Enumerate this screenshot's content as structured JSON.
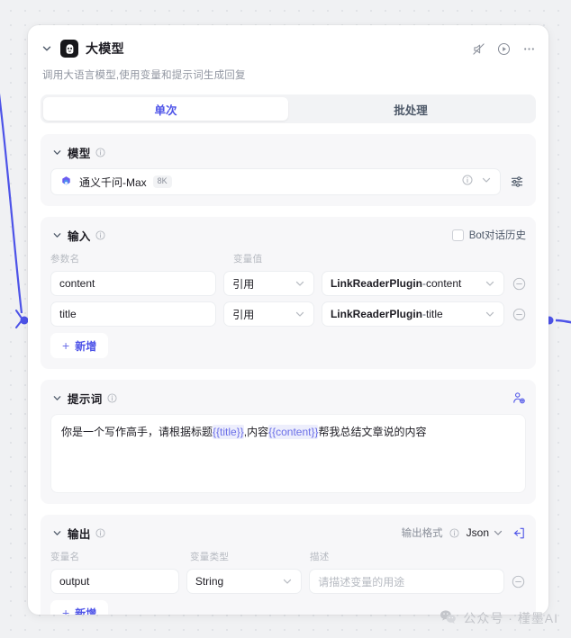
{
  "node": {
    "title": "大模型",
    "description": "调用大语言模型,使用变量和提示词生成回复",
    "avatar_icon": "bot-face-icon",
    "header_actions": [
      {
        "icon": "mute-disabled-icon",
        "name": "toggle-mute-button"
      },
      {
        "icon": "play-circle-icon",
        "name": "run-node-button"
      },
      {
        "icon": "ellipsis-icon",
        "name": "more-options-button"
      }
    ]
  },
  "tabs": [
    {
      "label": "单次",
      "active": true
    },
    {
      "label": "批处理",
      "active": false
    }
  ],
  "model_section": {
    "title": "模型",
    "selected": "通义千问-Max",
    "context_badge": "8K",
    "brand_icon": "qwen-logo-icon",
    "info_icon": "info-circle-icon",
    "dropdown_icon": "chevron-down-icon",
    "settings_icon": "sliders-icon"
  },
  "input_section": {
    "title": "输入",
    "bot_history_label": "Bot对话历史",
    "bot_history_checked": false,
    "columns": {
      "param": "参数名",
      "value": "变量值"
    },
    "rows": [
      {
        "param": "content",
        "ref_type": "引用",
        "source": "LinkReaderPlugin",
        "source_sep": " - ",
        "source_field": "content"
      },
      {
        "param": "title",
        "ref_type": "引用",
        "source": "LinkReaderPlugin",
        "source_sep": " - ",
        "source_field": "title"
      }
    ],
    "add_label": "新增"
  },
  "prompt_section": {
    "title": "提示词",
    "persona_icon": "user-persona-icon",
    "segments": [
      {
        "text": "你是一个写作高手，请根据标题",
        "variable": false
      },
      {
        "text": "{{title}}",
        "variable": true
      },
      {
        "text": ",内容",
        "variable": false
      },
      {
        "text": "{{content}}",
        "variable": true
      },
      {
        "text": "帮我总结文章说的内容",
        "variable": false
      }
    ]
  },
  "output_section": {
    "title": "输出",
    "format_label": "输出格式",
    "format_value": "Json",
    "export_icon": "export-box-icon",
    "columns": {
      "name": "变量名",
      "type": "变量类型",
      "desc": "描述"
    },
    "rows": [
      {
        "name": "output",
        "type": "String",
        "desc_placeholder": "请描述变量的用途"
      }
    ],
    "add_label": "新增"
  },
  "watermark": {
    "icon": "wechat-icon",
    "text": "公众号 · 槿墨AI"
  },
  "colors": {
    "accent": "#4d53e8",
    "canvas_bg": "#f0f1f3",
    "card_bg": "#ffffff",
    "section_bg": "#f7f7f9",
    "edge": "#4d53e8"
  }
}
